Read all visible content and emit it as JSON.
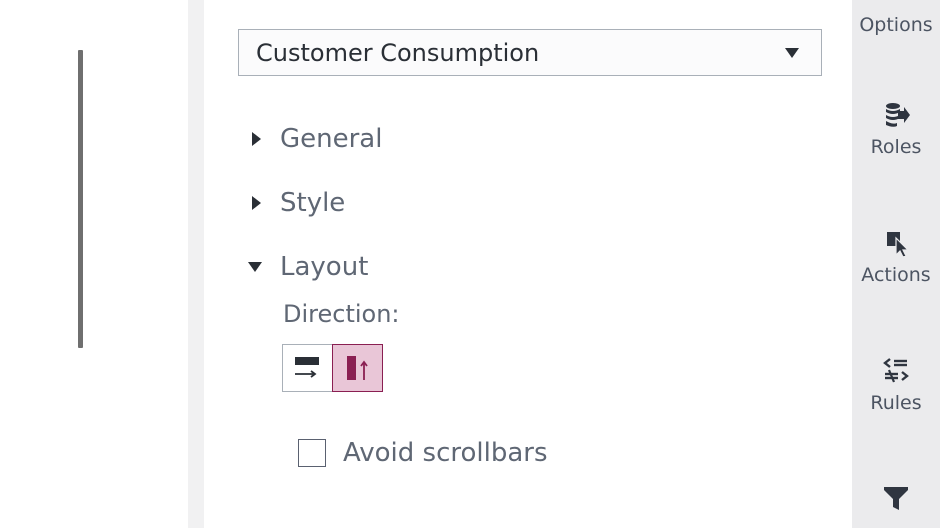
{
  "data_source": {
    "selected": "Customer Consumption"
  },
  "sections": {
    "general": {
      "label": "General",
      "expanded": false
    },
    "style": {
      "label": "Style",
      "expanded": false
    },
    "layout": {
      "label": "Layout",
      "expanded": true
    }
  },
  "layout": {
    "direction_label": "Direction:",
    "direction_options": [
      {
        "icon": "horizontal-direction-icon",
        "selected": false
      },
      {
        "icon": "vertical-direction-icon",
        "selected": true
      }
    ],
    "avoid_scrollbars": {
      "label": "Avoid scrollbars",
      "checked": false
    }
  },
  "right_rail": {
    "items": [
      {
        "label": "Options",
        "icon": ""
      },
      {
        "label": "Roles",
        "icon": "database-arrow-icon"
      },
      {
        "label": "Actions",
        "icon": "cursor-select-icon"
      },
      {
        "label": "Rules",
        "icon": "rules-icon"
      },
      {
        "label": "",
        "icon": "filter-icon"
      }
    ]
  },
  "colors": {
    "accent": "#8a1f52",
    "accent_fill": "#e9c6d7",
    "rail_background": "#ebebed"
  }
}
